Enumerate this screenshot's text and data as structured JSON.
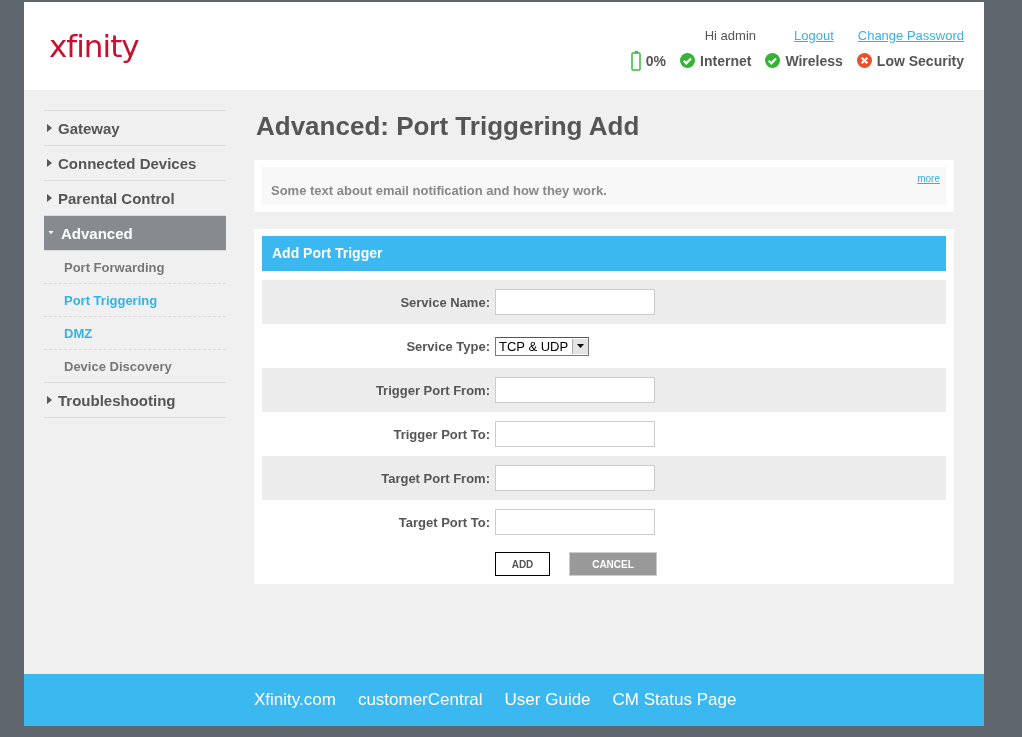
{
  "logo": "xfinity",
  "user": {
    "greeting": "Hi admin",
    "links": [
      "Logout",
      "Change Password"
    ]
  },
  "status": [
    {
      "kind": "battery",
      "label": "0%"
    },
    {
      "kind": "ok",
      "label": "Internet"
    },
    {
      "kind": "ok",
      "label": "Wireless"
    },
    {
      "kind": "error",
      "label": "Low Security"
    }
  ],
  "sidebar": {
    "items": [
      {
        "label": "Gateway",
        "expanded": false,
        "selected": false
      },
      {
        "label": "Connected Devices",
        "expanded": false,
        "selected": false
      },
      {
        "label": "Parental Control",
        "expanded": false,
        "selected": false
      },
      {
        "label": "Advanced",
        "expanded": true,
        "selected": true,
        "children": [
          {
            "label": "Port Forwarding",
            "color": "#777777"
          },
          {
            "label": "Port Triggering",
            "color": "#33b2e8"
          },
          {
            "label": "DMZ",
            "color": "#33b2e8"
          },
          {
            "label": "Device Discovery",
            "color": "#777777"
          }
        ]
      },
      {
        "label": "Troubleshooting",
        "expanded": false,
        "selected": false
      }
    ]
  },
  "page_title": "Advanced: Port Triggering Add",
  "info": {
    "text": "Some text about email notification and how they work.",
    "link": "more"
  },
  "form": {
    "title": "Add Port Trigger",
    "fields": [
      {
        "kind": "text",
        "label": "Service Name:"
      },
      {
        "kind": "select",
        "label": "Service Type:",
        "value": "TCP & UDP"
      },
      {
        "kind": "text",
        "label": "Trigger Port From:"
      },
      {
        "kind": "text",
        "label": "Trigger Port To:"
      },
      {
        "kind": "text",
        "label": "Target Port From:"
      },
      {
        "kind": "text",
        "label": "Target Port To:"
      }
    ],
    "buttons": [
      {
        "kind": "primary",
        "label": "ADD"
      },
      {
        "kind": "secondary",
        "label": "CANCEL"
      }
    ]
  },
  "footer": {
    "links": [
      "Xfinity.com",
      "customerCentral",
      "User Guide",
      "CM Status Page"
    ]
  }
}
